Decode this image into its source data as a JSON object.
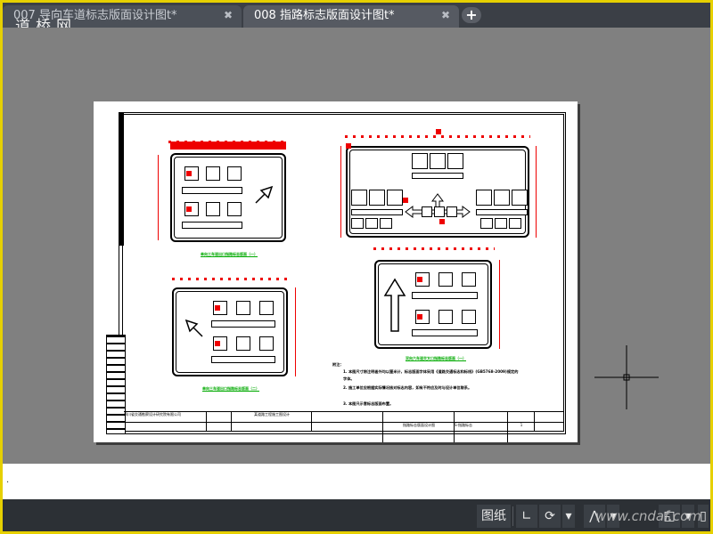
{
  "tabs": [
    {
      "label": "007  导向车道标志版面设计图t*",
      "active": false
    },
    {
      "label": "008  指路标志版面设计图t*",
      "active": true
    }
  ],
  "tab_add": "+",
  "tab_close": "✖",
  "watermark_top": "道桥网",
  "watermark_bottom": "www.cndaf.com",
  "statusbar": {
    "paper_label": "图纸",
    "arrow_label": "▾"
  },
  "drawing": {
    "captions": [
      "单向三车道出口指路标志版面（一）",
      "单向三车道出口指路标志版面（二）",
      "双向六车道交叉口指路标志版面（一）",
      "双向六车道交叉口指路标志版面（二）"
    ],
    "notes": [
      "附注：",
      "1. 本图尺寸除注明者外均以厘米计，标志版面字体采用《道路交通标志和标线》(GB5768-2009)规定的字体。",
      "2. 施工单位应根据实际情况核对标志内容，如有不符应及时与设计单位联系。",
      "3. 本图只示意标志版面布置。"
    ],
    "titleblock": {
      "company": "四川省交通勘察设计研究院有限公司",
      "project": "某道路工程施工图设计",
      "title": "指路标志版面设计图",
      "drawing_no": "S-指路标志",
      "sheet": "1"
    }
  },
  "colors": {
    "accent_border": "#e6d000",
    "tab_bg": "#3b3f46",
    "canvas_bg": "#808080",
    "statusbar_bg": "#2c3035",
    "dimension_red": "#e00000",
    "caption_green": "#00aa00"
  }
}
